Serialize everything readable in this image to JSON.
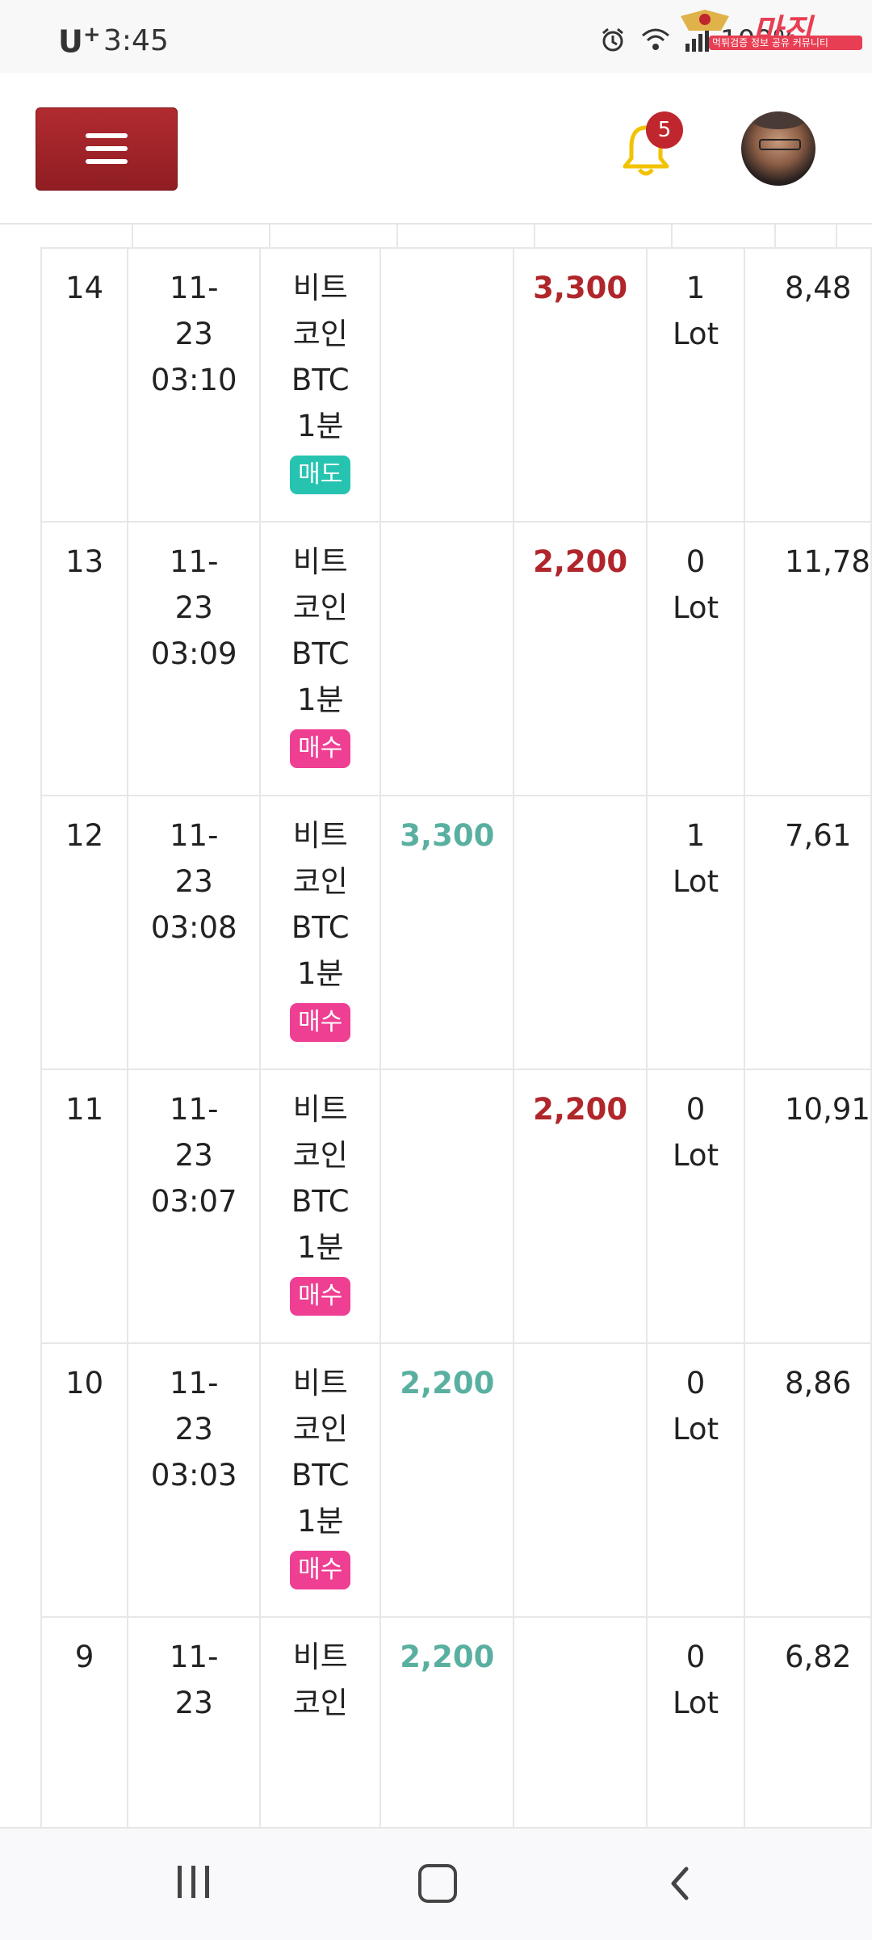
{
  "status_bar": {
    "carrier": "U",
    "carrier_sup": "+",
    "time": "3:45",
    "battery": "100%",
    "watermark": "마진",
    "watermark_sub": "먹튀검증 정보 공유 커뮤니티"
  },
  "header": {
    "menu_icon": "hamburger-icon",
    "notification_count": "5",
    "bell_icon": "bell-icon"
  },
  "rows": [
    {
      "no": "14",
      "date": "11-",
      "date2": "23",
      "time": "03:10",
      "item1": "비트",
      "item2": "코인",
      "item3": "BTC",
      "item4": "1분",
      "side": "매도",
      "side_type": "sell",
      "profit": "",
      "loss": "3,300",
      "lot": "1",
      "lot_unit": "Lot",
      "balance": "8,48"
    },
    {
      "no": "13",
      "date": "11-",
      "date2": "23",
      "time": "03:09",
      "item1": "비트",
      "item2": "코인",
      "item3": "BTC",
      "item4": "1분",
      "side": "매수",
      "side_type": "buy",
      "profit": "",
      "loss": "2,200",
      "lot": "0",
      "lot_unit": "Lot",
      "balance": "11,78"
    },
    {
      "no": "12",
      "date": "11-",
      "date2": "23",
      "time": "03:08",
      "item1": "비트",
      "item2": "코인",
      "item3": "BTC",
      "item4": "1분",
      "side": "매수",
      "side_type": "buy",
      "profit": "3,300",
      "loss": "",
      "lot": "1",
      "lot_unit": "Lot",
      "balance": "7,61"
    },
    {
      "no": "11",
      "date": "11-",
      "date2": "23",
      "time": "03:07",
      "item1": "비트",
      "item2": "코인",
      "item3": "BTC",
      "item4": "1분",
      "side": "매수",
      "side_type": "buy",
      "profit": "",
      "loss": "2,200",
      "lot": "0",
      "lot_unit": "Lot",
      "balance": "10,91"
    },
    {
      "no": "10",
      "date": "11-",
      "date2": "23",
      "time": "03:03",
      "item1": "비트",
      "item2": "코인",
      "item3": "BTC",
      "item4": "1분",
      "side": "매수",
      "side_type": "buy",
      "profit": "2,200",
      "loss": "",
      "lot": "0",
      "lot_unit": "Lot",
      "balance": "8,86"
    },
    {
      "no": "9",
      "date": "11-",
      "date2": "23",
      "time": "",
      "item1": "비트",
      "item2": "코인",
      "item3": "",
      "item4": "",
      "side": "",
      "side_type": "",
      "profit": "2,200",
      "loss": "",
      "lot": "0",
      "lot_unit": "Lot",
      "balance": "6,82"
    }
  ],
  "nav": {
    "recent_icon": "recent-apps-icon",
    "home_icon": "home-icon",
    "back_icon": "back-icon"
  },
  "colors": {
    "menu_button": "#a0242a",
    "profit": "#5ab0a0",
    "loss": "#b0262b",
    "sell_tag": "#26c4b0",
    "buy_tag": "#ef3f92",
    "badge": "#c0262d",
    "bell": "#f2c200"
  }
}
